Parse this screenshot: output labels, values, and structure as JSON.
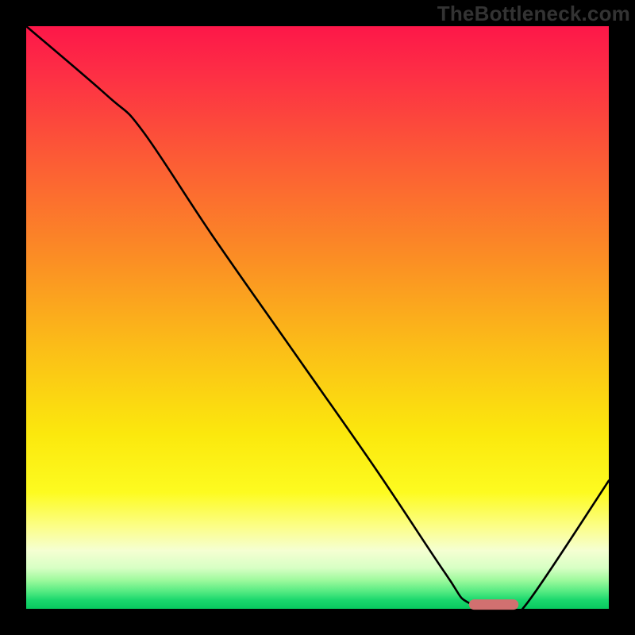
{
  "watermark": "TheBottleneck.com",
  "chart_data": {
    "type": "line",
    "title": "",
    "xlabel": "",
    "ylabel": "",
    "xlim": [
      0,
      100
    ],
    "ylim": [
      0,
      100
    ],
    "grid": false,
    "legend": false,
    "series": [
      {
        "name": "bottleneck-curve",
        "x": [
          0,
          14,
          20,
          32,
          46,
          60,
          72,
          76,
          83,
          86,
          100
        ],
        "values": [
          100,
          88,
          82,
          64,
          44,
          24,
          6,
          1,
          0,
          1,
          22
        ]
      }
    ],
    "marker": {
      "name": "optimal-range",
      "shape": "rounded-bar",
      "x_start": 76,
      "x_end": 84.5,
      "y": 0.8,
      "color": "#d17070"
    },
    "background_gradient": {
      "top": "#fd1749",
      "mid_upper": "#fb8e24",
      "mid": "#fbe80d",
      "mid_lower": "#fdfb20",
      "bottom": "#08c95f"
    }
  }
}
